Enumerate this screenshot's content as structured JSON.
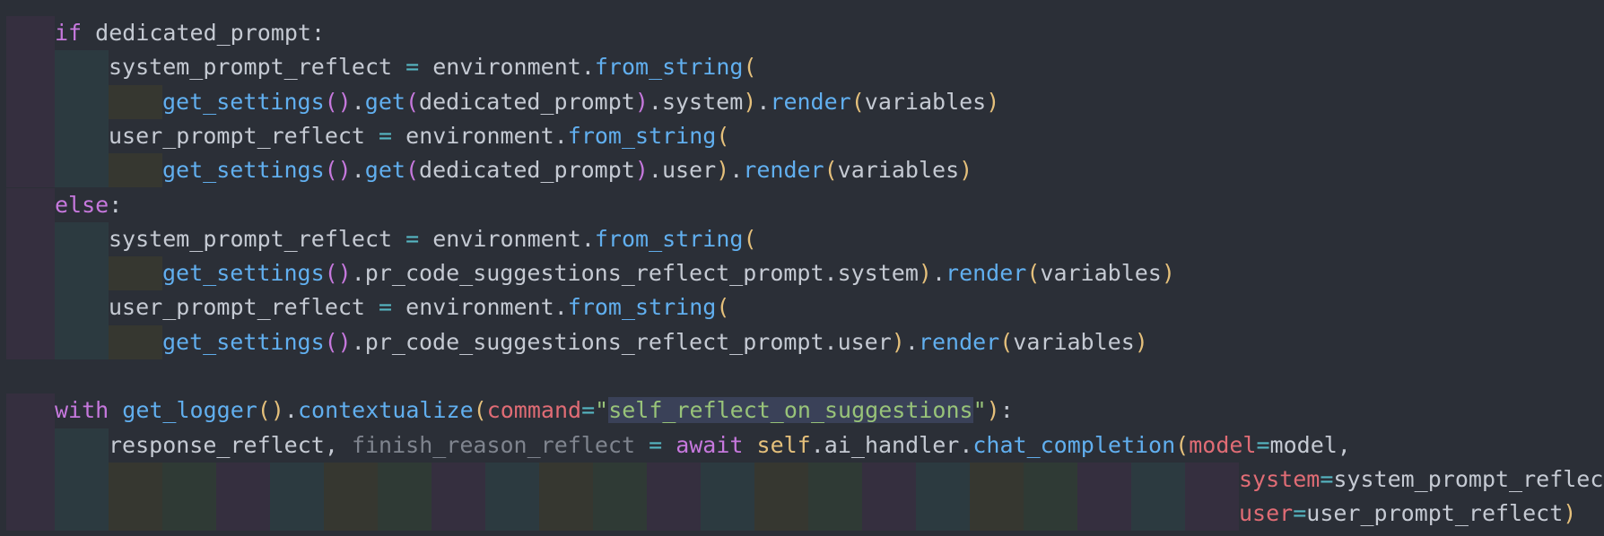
{
  "editor": {
    "language": "python",
    "colors": {
      "background": "#2b2f37",
      "keyword": "#c678dd",
      "function": "#61afef",
      "paren_outer": "#c678dd",
      "paren_inner": "#e5c07b",
      "parameter": "#e06c75",
      "operator": "#56b6c2",
      "string": "#98c379",
      "self": "#e5c07b",
      "dimmed": "#7f848e",
      "plain": "#c5cad3",
      "selection": "#3a4158"
    },
    "lines": [
      {
        "indent": 0,
        "tokens": [
          {
            "t": "if",
            "c": "kw"
          },
          {
            "t": " dedicated_prompt:",
            "c": "plain"
          }
        ]
      },
      {
        "indent": 1,
        "tokens": [
          {
            "t": "system_prompt_reflect ",
            "c": "plain"
          },
          {
            "t": "=",
            "c": "op"
          },
          {
            "t": " environment.",
            "c": "plain"
          },
          {
            "t": "from_string",
            "c": "fn"
          },
          {
            "t": "(",
            "c": "paren-y"
          }
        ]
      },
      {
        "indent": 2,
        "tokens": [
          {
            "t": "get_settings",
            "c": "fn"
          },
          {
            "t": "()",
            "c": "paren-p"
          },
          {
            "t": ".",
            "c": "plain"
          },
          {
            "t": "get",
            "c": "fn"
          },
          {
            "t": "(",
            "c": "paren-p"
          },
          {
            "t": "dedicated_prompt",
            "c": "plain"
          },
          {
            "t": ")",
            "c": "paren-p"
          },
          {
            "t": ".system",
            "c": "plain"
          },
          {
            "t": ")",
            "c": "paren-y"
          },
          {
            "t": ".",
            "c": "plain"
          },
          {
            "t": "render",
            "c": "fn"
          },
          {
            "t": "(",
            "c": "paren-y"
          },
          {
            "t": "variables",
            "c": "plain"
          },
          {
            "t": ")",
            "c": "paren-y"
          }
        ]
      },
      {
        "indent": 1,
        "tokens": [
          {
            "t": "user_prompt_reflect ",
            "c": "plain"
          },
          {
            "t": "=",
            "c": "op"
          },
          {
            "t": " environment.",
            "c": "plain"
          },
          {
            "t": "from_string",
            "c": "fn"
          },
          {
            "t": "(",
            "c": "paren-y"
          }
        ]
      },
      {
        "indent": 2,
        "tokens": [
          {
            "t": "get_settings",
            "c": "fn"
          },
          {
            "t": "()",
            "c": "paren-p"
          },
          {
            "t": ".",
            "c": "plain"
          },
          {
            "t": "get",
            "c": "fn"
          },
          {
            "t": "(",
            "c": "paren-p"
          },
          {
            "t": "dedicated_prompt",
            "c": "plain"
          },
          {
            "t": ")",
            "c": "paren-p"
          },
          {
            "t": ".user",
            "c": "plain"
          },
          {
            "t": ")",
            "c": "paren-y"
          },
          {
            "t": ".",
            "c": "plain"
          },
          {
            "t": "render",
            "c": "fn"
          },
          {
            "t": "(",
            "c": "paren-y"
          },
          {
            "t": "variables",
            "c": "plain"
          },
          {
            "t": ")",
            "c": "paren-y"
          }
        ]
      },
      {
        "indent": 0,
        "tokens": [
          {
            "t": "else",
            "c": "kw"
          },
          {
            "t": ":",
            "c": "plain"
          }
        ]
      },
      {
        "indent": 1,
        "tokens": [
          {
            "t": "system_prompt_reflect ",
            "c": "plain"
          },
          {
            "t": "=",
            "c": "op"
          },
          {
            "t": " environment.",
            "c": "plain"
          },
          {
            "t": "from_string",
            "c": "fn"
          },
          {
            "t": "(",
            "c": "paren-y"
          }
        ]
      },
      {
        "indent": 2,
        "tokens": [
          {
            "t": "get_settings",
            "c": "fn"
          },
          {
            "t": "()",
            "c": "paren-p"
          },
          {
            "t": ".pr_code_suggestions_reflect_prompt.system",
            "c": "plain"
          },
          {
            "t": ")",
            "c": "paren-y"
          },
          {
            "t": ".",
            "c": "plain"
          },
          {
            "t": "render",
            "c": "fn"
          },
          {
            "t": "(",
            "c": "paren-y"
          },
          {
            "t": "variables",
            "c": "plain"
          },
          {
            "t": ")",
            "c": "paren-y"
          }
        ]
      },
      {
        "indent": 1,
        "tokens": [
          {
            "t": "user_prompt_reflect ",
            "c": "plain"
          },
          {
            "t": "=",
            "c": "op"
          },
          {
            "t": " environment.",
            "c": "plain"
          },
          {
            "t": "from_string",
            "c": "fn"
          },
          {
            "t": "(",
            "c": "paren-y"
          }
        ]
      },
      {
        "indent": 2,
        "tokens": [
          {
            "t": "get_settings",
            "c": "fn"
          },
          {
            "t": "()",
            "c": "paren-p"
          },
          {
            "t": ".pr_code_suggestions_reflect_prompt.user",
            "c": "plain"
          },
          {
            "t": ")",
            "c": "paren-y"
          },
          {
            "t": ".",
            "c": "plain"
          },
          {
            "t": "render",
            "c": "fn"
          },
          {
            "t": "(",
            "c": "paren-y"
          },
          {
            "t": "variables",
            "c": "plain"
          },
          {
            "t": ")",
            "c": "paren-y"
          }
        ]
      },
      {
        "indent": 0,
        "tokens": []
      },
      {
        "indent": 0,
        "tokens": [
          {
            "t": "with",
            "c": "kw"
          },
          {
            "t": " ",
            "c": "plain"
          },
          {
            "t": "get_logger",
            "c": "fn"
          },
          {
            "t": "()",
            "c": "paren-y"
          },
          {
            "t": ".",
            "c": "plain"
          },
          {
            "t": "contextualize",
            "c": "fn"
          },
          {
            "t": "(",
            "c": "paren-y"
          },
          {
            "t": "command",
            "c": "param"
          },
          {
            "t": "=",
            "c": "op"
          },
          {
            "t": "\"",
            "c": "str"
          },
          {
            "t": "self_reflect_on_suggestions",
            "c": "str",
            "sel": true
          },
          {
            "t": "\"",
            "c": "str"
          },
          {
            "t": ")",
            "c": "paren-y"
          },
          {
            "t": ":",
            "c": "plain"
          }
        ]
      },
      {
        "indent": 1,
        "tokens": [
          {
            "t": "response_reflect, ",
            "c": "plain"
          },
          {
            "t": "finish_reason_reflect",
            "c": "dim"
          },
          {
            "t": " ",
            "c": "plain"
          },
          {
            "t": "=",
            "c": "op"
          },
          {
            "t": " ",
            "c": "plain"
          },
          {
            "t": "await",
            "c": "kw"
          },
          {
            "t": " ",
            "c": "plain"
          },
          {
            "t": "self",
            "c": "self"
          },
          {
            "t": ".ai_handler.",
            "c": "plain"
          },
          {
            "t": "chat_completion",
            "c": "fn"
          },
          {
            "t": "(",
            "c": "paren-y"
          },
          {
            "t": "model",
            "c": "param"
          },
          {
            "t": "=",
            "c": "op"
          },
          {
            "t": "model,",
            "c": "plain"
          }
        ]
      },
      {
        "indent": 22,
        "tokens": [
          {
            "t": "system",
            "c": "param"
          },
          {
            "t": "=",
            "c": "op"
          },
          {
            "t": "system_prompt_reflect,",
            "c": "plain"
          }
        ]
      },
      {
        "indent": 22,
        "tokens": [
          {
            "t": "user",
            "c": "param"
          },
          {
            "t": "=",
            "c": "op"
          },
          {
            "t": "user_prompt_reflect",
            "c": "plain"
          },
          {
            "t": ")",
            "c": "paren-y"
          }
        ]
      }
    ]
  }
}
